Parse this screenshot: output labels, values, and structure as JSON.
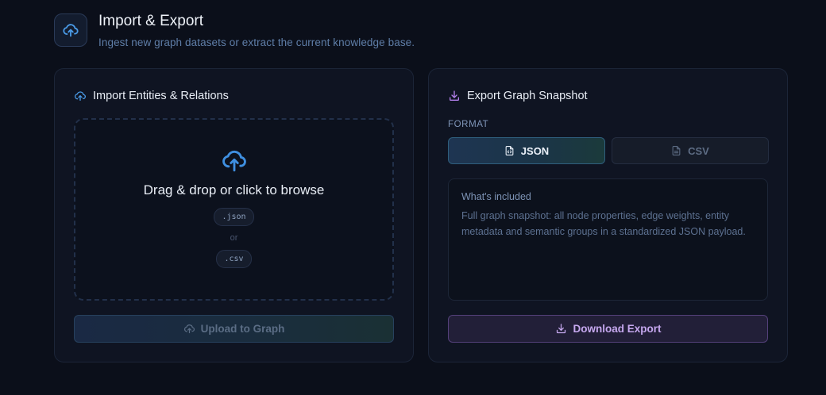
{
  "header": {
    "title": "Import & Export",
    "subtitle": "Ingest new graph datasets or extract the current knowledge base.",
    "icon": "cloud-upload-icon"
  },
  "import_card": {
    "title": "Import Entities & Relations",
    "icon": "cloud-upload-icon",
    "dropzone": {
      "title": "Drag & drop or click to browse",
      "formats": [
        ".json",
        ".csv"
      ],
      "or_label": "or"
    },
    "upload_button": "Upload to Graph"
  },
  "export_card": {
    "title": "Export Graph Snapshot",
    "icon": "download-icon",
    "format_label": "FORMAT",
    "formats": [
      {
        "label": "JSON",
        "selected": true
      },
      {
        "label": "CSV",
        "selected": false
      }
    ],
    "info": {
      "title": "What's included",
      "body": "Full graph snapshot: all node properties, edge weights, entity metadata and semantic groups in a standardized JSON payload."
    },
    "download_button": "Download Export"
  },
  "colors": {
    "background": "#0b0f1a",
    "accent_blue": "#3f8fe0",
    "accent_purple": "#b07ee8"
  }
}
